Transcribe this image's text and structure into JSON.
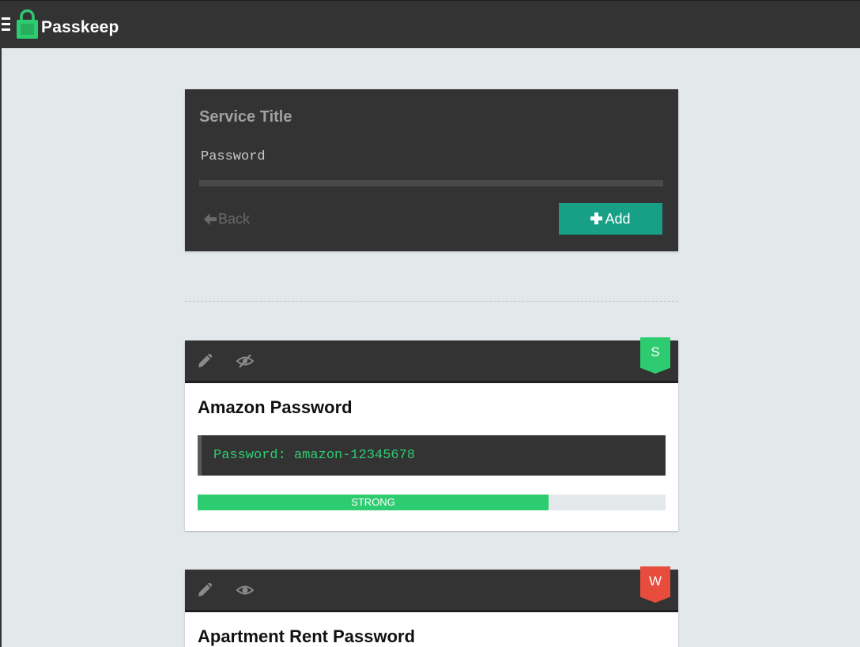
{
  "app": {
    "brand": "Passkeep",
    "icons": {
      "menu": "hamburger-menu-icon",
      "logo": "padlock-logo-icon"
    },
    "colors": {
      "topbar": "#333333",
      "logo": "#2ecc71"
    }
  },
  "form": {
    "title_placeholder": "Service Title",
    "password_placeholder": "Password",
    "back_label": "Back",
    "add_label": "Add",
    "icons": {
      "back": "arrow-left-icon",
      "add": "plus-icon"
    },
    "colors": {
      "add_button": "#17a085"
    }
  },
  "passwords": [
    {
      "title": "Amazon Password",
      "password_text": "Password: amazon-12345678",
      "badge": "S",
      "badge_color": "#2ecc71",
      "visibility_icon": "eye-slash-icon",
      "strength": {
        "label": "STRONG",
        "fraction": 0.75,
        "color": "#2ecc71"
      }
    },
    {
      "title": "Apartment Rent Password",
      "badge": "W",
      "badge_color": "#e74c3c",
      "visibility_icon": "eye-icon"
    }
  ]
}
